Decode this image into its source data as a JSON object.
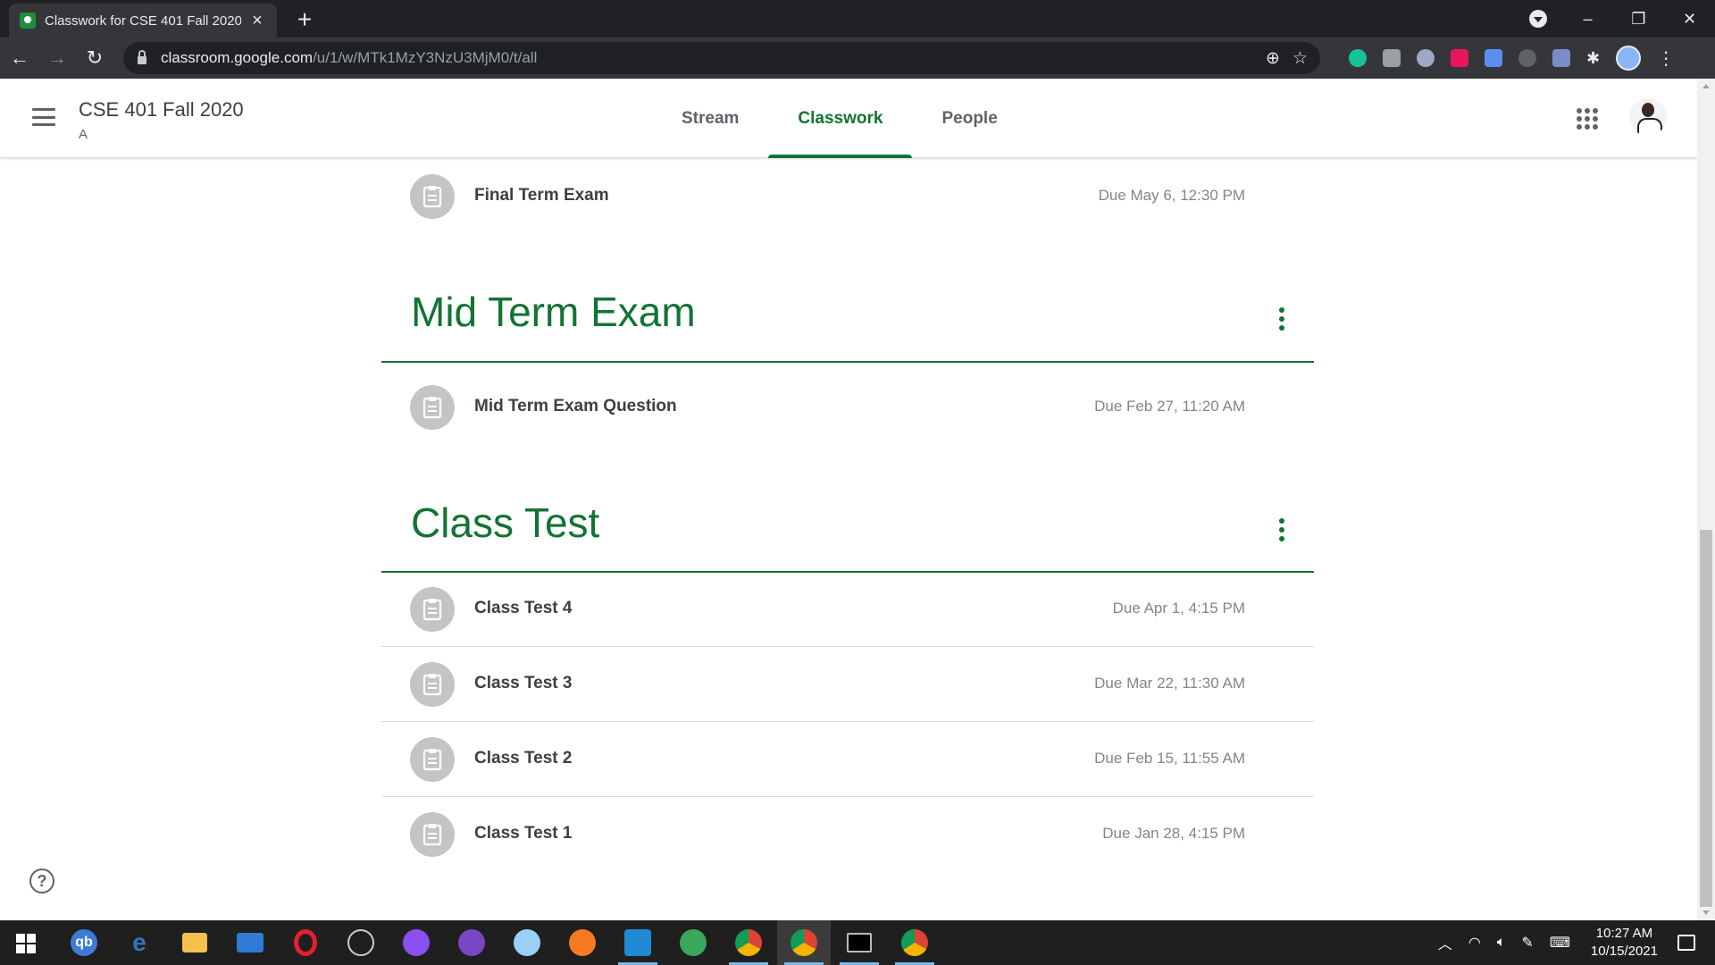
{
  "browser": {
    "tab_title": "Classwork for CSE 401 Fall 2020 /",
    "url_host": "classroom.google.com",
    "url_path": "/u/1/w/MTk1MzY3NzU3MjM0/t/all"
  },
  "header": {
    "course_title": "CSE 401 Fall 2020",
    "course_section": "A",
    "tabs": [
      {
        "label": "Stream",
        "active": false
      },
      {
        "label": "Classwork",
        "active": true
      },
      {
        "label": "People",
        "active": false
      }
    ]
  },
  "classwork": {
    "top_item": {
      "title": "Final Term Exam",
      "due": "Due May 6, 12:30 PM"
    },
    "topics": [
      {
        "title": "Mid Term Exam",
        "items": [
          {
            "title": "Mid Term Exam Question",
            "due": "Due Feb 27, 11:20 AM"
          }
        ]
      },
      {
        "title": "Class Test",
        "items": [
          {
            "title": "Class Test 4",
            "due": "Due Apr 1, 4:15 PM"
          },
          {
            "title": "Class Test 3",
            "due": "Due Mar 22, 11:30 AM"
          },
          {
            "title": "Class Test 2",
            "due": "Due Feb 15, 11:55 AM"
          },
          {
            "title": "Class Test 1",
            "due": "Due Jan 28, 4:15 PM"
          }
        ]
      }
    ]
  },
  "help": {
    "glyph": "?"
  },
  "taskbar": {
    "time": "10:27 AM",
    "date": "10/15/2021"
  },
  "colors": {
    "accent": "#137333",
    "browser_frame": "#202124",
    "toolbar": "#35363a",
    "taskbar": "#1f1f1f"
  }
}
